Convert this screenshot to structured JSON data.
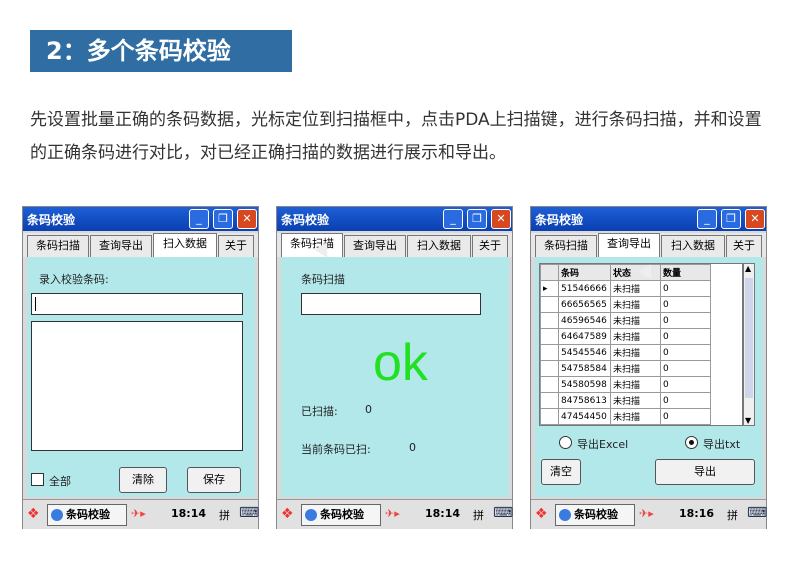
{
  "header": {
    "title": "2：多个条码校验"
  },
  "description": "先设置批量正确的条码数据，光标定位到扫描框中，点击PDA上扫描键，进行条码扫描，并和设置的正确条码进行对比，对已经正确扫描的数据进行展示和导出。",
  "app_title": "条码校验",
  "tabs": [
    "条码扫描",
    "查询导出",
    "扫入数据",
    "关于"
  ],
  "win1": {
    "label": "录入校验条码:",
    "input_value": "",
    "checkbox_label": "全部",
    "clear_label": "清除",
    "save_label": "保存"
  },
  "win2": {
    "label": "条码扫描",
    "input_value": "",
    "status": "ok",
    "scanned_label": "已扫描:",
    "scanned_count": "0",
    "current_label": "当前条码已扫:",
    "current_count": "0"
  },
  "win3": {
    "columns": [
      "条码",
      "状态",
      "数量"
    ],
    "rows": [
      [
        "51546666",
        "未扫描",
        "0"
      ],
      [
        "66656565",
        "未扫描",
        "0"
      ],
      [
        "46596546",
        "未扫描",
        "0"
      ],
      [
        "64647589",
        "未扫描",
        "0"
      ],
      [
        "54545546",
        "未扫描",
        "0"
      ],
      [
        "54758584",
        "未扫描",
        "0"
      ],
      [
        "54580598",
        "未扫描",
        "0"
      ],
      [
        "84758613",
        "未扫描",
        "0"
      ],
      [
        "47454450",
        "未扫描",
        "0"
      ]
    ],
    "radio_excel": "导出Excel",
    "radio_txt": "导出txt",
    "clear_label": "清空",
    "export_label": "导出"
  },
  "taskbar": {
    "app_label": "条码校验",
    "time1": "18:14",
    "time2": "18:14",
    "time3": "18:16",
    "ime": "拼"
  },
  "colors": {
    "header_bg": "#2f6da2",
    "panel_bg": "#b3e8ea",
    "ok_color": "#22e022",
    "titlebar": "#1e5fd6"
  }
}
